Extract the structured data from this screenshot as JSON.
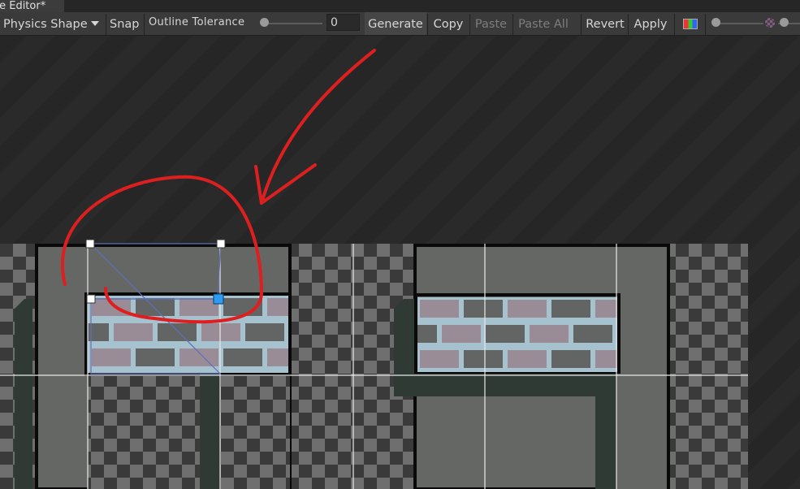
{
  "window": {
    "title": "te Editor*"
  },
  "toolbar": {
    "mode_label": "Physics Shape",
    "snap_label": "Snap",
    "outline_tolerance_label": "Outline Tolerance",
    "outline_tolerance_value": "0",
    "generate_label": "Generate",
    "copy_label": "Copy",
    "paste_label": "Paste",
    "paste_all_label": "Paste All",
    "revert_label": "Revert",
    "apply_label": "Apply"
  },
  "icons": {
    "dropdown": "chevron-down-icon",
    "color_channels": "rgb-channels-icon",
    "alpha": "checkerboard-icon"
  },
  "colors": {
    "toolbar_bg": "#3a3a3a",
    "canvas_bg": "#262626",
    "annotation": "#dd1f1f",
    "selection_handle": "#2b9cf2",
    "tile_wall": "#656765",
    "tile_shadow": "#2f3a35",
    "brick_mauve": "#9a8c96",
    "brick_gray": "#636565",
    "mortar": "#a7c2cf"
  }
}
